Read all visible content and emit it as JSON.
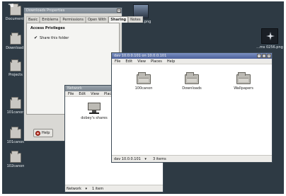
{
  "desktop": {
    "icons": [
      {
        "label": "Documents"
      },
      {
        "label": "Downloads"
      },
      {
        "label": "Projects"
      },
      {
        "label": "101canon"
      },
      {
        "label": "101canon"
      },
      {
        "label": "102canon"
      }
    ],
    "thumbs": [
      {
        "label": "...0240.png"
      },
      {
        "label": "...ms 0256.png"
      }
    ]
  },
  "properties": {
    "title": "Downloads Properties",
    "tabs": [
      "Basic",
      "Emblems",
      "Permissions",
      "Open With",
      "Sharing",
      "Notes"
    ],
    "selected_tab": "Sharing",
    "section_heading": "Access Privileges",
    "share_checkbox_label": "Share this folder",
    "share_checked": true,
    "help_label": "Help"
  },
  "network": {
    "title": "Network",
    "menu": [
      "File",
      "Edit",
      "View",
      "Places"
    ],
    "item_label": "dobey's shares",
    "location": "Network",
    "status": "1 item"
  },
  "dav": {
    "title": "dav 10.0.0.101 on 10.0.0.101",
    "menu": [
      "File",
      "Edit",
      "View",
      "Places",
      "Help"
    ],
    "folders": [
      "100canon",
      "Downloads",
      "Wallpapers"
    ],
    "location": "dav 10.0.0.101",
    "status": "3 items"
  }
}
